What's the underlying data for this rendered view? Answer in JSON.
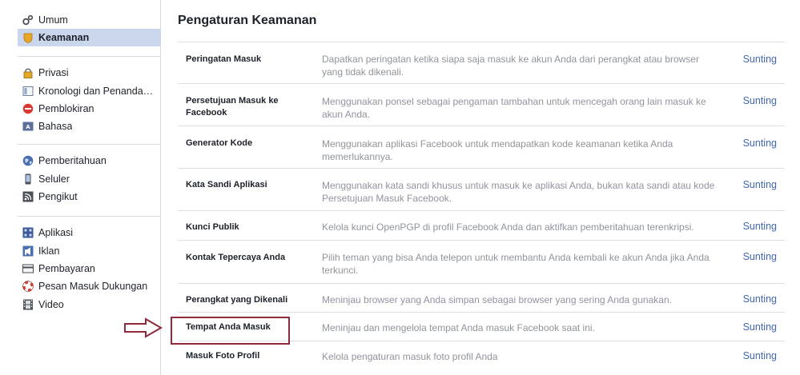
{
  "sidebar": {
    "groups": [
      [
        {
          "label": "Umum",
          "icon": "gear-icon"
        },
        {
          "label": "Keamanan",
          "icon": "shield-icon",
          "selected": true
        }
      ],
      [
        {
          "label": "Privasi",
          "icon": "lock-icon"
        },
        {
          "label": "Kronologi dan Penanda…",
          "icon": "timeline-icon"
        },
        {
          "label": "Pemblokiran",
          "icon": "block-icon"
        },
        {
          "label": "Bahasa",
          "icon": "language-icon"
        }
      ],
      [
        {
          "label": "Pemberitahuan",
          "icon": "globe-icon"
        },
        {
          "label": "Seluler",
          "icon": "mobile-icon"
        },
        {
          "label": "Pengikut",
          "icon": "rss-icon"
        }
      ],
      [
        {
          "label": "Aplikasi",
          "icon": "apps-icon"
        },
        {
          "label": "Iklan",
          "icon": "ads-icon"
        },
        {
          "label": "Pembayaran",
          "icon": "card-icon"
        },
        {
          "label": "Pesan Masuk Dukungan",
          "icon": "lifebuoy-icon"
        },
        {
          "label": "Video",
          "icon": "film-icon"
        }
      ]
    ]
  },
  "main": {
    "title": "Pengaturan Keamanan",
    "edit_label": "Sunting",
    "rows": [
      {
        "name": "Peringatan Masuk",
        "desc": "Dapatkan peringatan ketika siapa saja masuk ke akun Anda dari perangkat atau browser yang tidak dikenali."
      },
      {
        "name": "Persetujuan Masuk ke Facebook",
        "desc": "Menggunakan ponsel sebagai pengaman tambahan untuk mencegah orang lain masuk ke akun Anda."
      },
      {
        "name": "Generator Kode",
        "desc": "Menggunakan aplikasi Facebook untuk mendapatkan kode keamanan ketika Anda memerlukannya."
      },
      {
        "name": "Kata Sandi Aplikasi",
        "desc": "Menggunakan kata sandi khusus untuk masuk ke aplikasi Anda, bukan kata sandi atau kode Persetujuan Masuk Facebook."
      },
      {
        "name": "Kunci Publik",
        "desc": "Kelola kunci OpenPGP di profil Facebook Anda dan aktifkan pemberitahuan terenkripsi."
      },
      {
        "name": "Kontak Tepercaya Anda",
        "desc": "Pilih teman yang bisa Anda telepon untuk membantu Anda kembali ke akun Anda jika Anda terkunci."
      },
      {
        "name": "Perangkat yang Dikenali",
        "desc": "Meninjau browser yang Anda simpan sebagai browser yang sering Anda gunakan."
      },
      {
        "name": "Tempat Anda Masuk",
        "desc": "Meninjau dan mengelola tempat Anda masuk Facebook saat ini."
      },
      {
        "name": "Masuk Foto Profil",
        "desc": "Kelola pengaturan masuk foto profil Anda"
      }
    ]
  },
  "colors": {
    "link": "#4267b2",
    "selected_bg": "#c9d6eb",
    "annotation": "#8e2a3c"
  }
}
